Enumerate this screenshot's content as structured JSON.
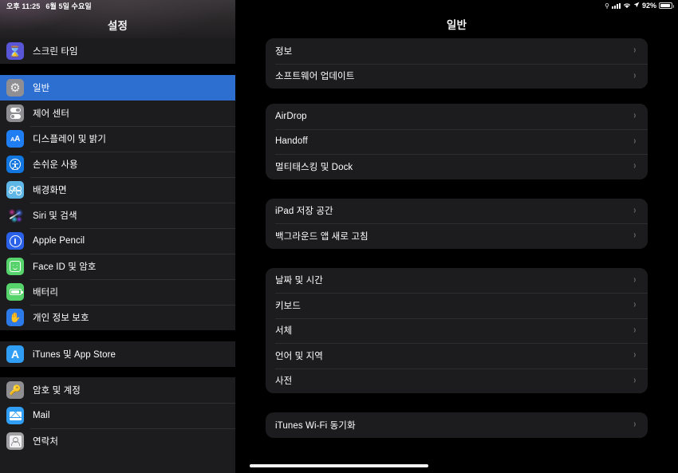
{
  "status_bar": {
    "time": "오후 11:25",
    "date": "6월 5일 수요일",
    "battery_percent": "92%",
    "battery_level": 92,
    "icons": [
      "lock-rotation-icon",
      "cellular-bars-icon",
      "wifi-icon",
      "location-arrow-icon",
      "battery-icon"
    ]
  },
  "sidebar": {
    "title": "설정",
    "groups": [
      {
        "items": [
          {
            "label": "스크린 타임",
            "icon": "hourglass-icon",
            "icon_class": "ic-screentime",
            "selected": false
          }
        ]
      },
      {
        "items": [
          {
            "label": "일반",
            "icon": "gear-icon",
            "icon_class": "ic-general",
            "selected": true
          },
          {
            "label": "제어 센터",
            "icon": "toggles-icon",
            "icon_class": "ic-control",
            "selected": false
          },
          {
            "label": "디스플레이 및 밝기",
            "icon": "text-size-icon",
            "icon_class": "ic-display",
            "selected": false
          },
          {
            "label": "손쉬운 사용",
            "icon": "accessibility-icon",
            "icon_class": "ic-access",
            "selected": false
          },
          {
            "label": "배경화면",
            "icon": "flower-icon",
            "icon_class": "ic-wallpaper",
            "selected": false
          },
          {
            "label": "Siri 및 검색",
            "icon": "siri-icon",
            "icon_class": "ic-siri",
            "selected": false
          },
          {
            "label": "Apple Pencil",
            "icon": "pencil-icon",
            "icon_class": "ic-pencil",
            "selected": false
          },
          {
            "label": "Face ID 및 암호",
            "icon": "faceid-icon",
            "icon_class": "ic-faceid",
            "selected": false
          },
          {
            "label": "배터리",
            "icon": "battery-icon",
            "icon_class": "ic-battery",
            "selected": false
          },
          {
            "label": "개인 정보 보호",
            "icon": "hand-icon",
            "icon_class": "ic-privacy",
            "selected": false
          }
        ]
      },
      {
        "items": [
          {
            "label": "iTunes 및 App Store",
            "icon": "app-store-icon",
            "icon_class": "ic-appstore",
            "selected": false
          }
        ]
      },
      {
        "items": [
          {
            "label": "암호 및 계정",
            "icon": "key-icon",
            "icon_class": "ic-password",
            "selected": false
          },
          {
            "label": "Mail",
            "icon": "envelope-icon",
            "icon_class": "ic-mail",
            "selected": false
          },
          {
            "label": "연락처",
            "icon": "contacts-icon",
            "icon_class": "ic-contacts",
            "selected": false
          }
        ]
      }
    ]
  },
  "main": {
    "title": "일반",
    "chevron": "›",
    "groups": [
      {
        "rows": [
          {
            "label": "정보"
          },
          {
            "label": "소프트웨어 업데이트"
          }
        ]
      },
      {
        "rows": [
          {
            "label": "AirDrop"
          },
          {
            "label": "Handoff"
          },
          {
            "label": "멀티태스킹 및 Dock"
          }
        ]
      },
      {
        "rows": [
          {
            "label": "iPad 저장 공간"
          },
          {
            "label": "백그라운드 앱 새로 고침"
          }
        ]
      },
      {
        "rows": [
          {
            "label": "날짜 및 시간"
          },
          {
            "label": "키보드"
          },
          {
            "label": "서체"
          },
          {
            "label": "언어 및 지역"
          },
          {
            "label": "사전"
          }
        ]
      },
      {
        "rows": [
          {
            "label": "iTunes Wi-Fi 동기화"
          }
        ]
      }
    ]
  },
  "colors": {
    "selection_blue": "#2c6fd1",
    "card_background": "#1c1c1e",
    "page_background": "#000000",
    "separator": "#2e2e30",
    "chevron_gray": "#6c6c70"
  }
}
